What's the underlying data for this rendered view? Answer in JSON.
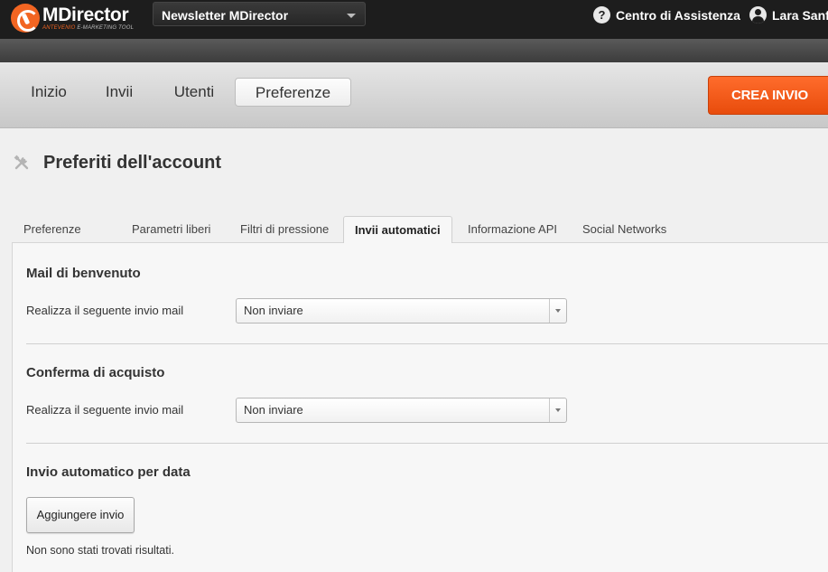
{
  "header": {
    "logo": {
      "name": "MDirector",
      "tagline_brand": "ANTEVENIO",
      "tagline_rest": "E-MARKETING TOOL",
      "accent": "#f26522"
    },
    "newsletter_select": {
      "value": "Newsletter MDirector"
    },
    "help": {
      "label": "Centro di Assistenza",
      "icon": "question-icon"
    },
    "user": {
      "name": "Lara Sanf",
      "icon": "user-icon"
    }
  },
  "nav": {
    "items": [
      {
        "label": "Inizio"
      },
      {
        "label": "Invii"
      },
      {
        "label": "Utenti"
      },
      {
        "label": "Preferenze",
        "active": true
      }
    ],
    "cta_label": "CREA INVIO",
    "cta_color": "#f05a1a"
  },
  "page": {
    "title": "Preferiti dell'account",
    "icon": "tools-icon"
  },
  "tabs": [
    {
      "label": "Preferenze"
    },
    {
      "label": "Parametri liberi"
    },
    {
      "label": "Filtri di pressione"
    },
    {
      "label": "Invii automatici",
      "active": true
    },
    {
      "label": "Informazione API"
    },
    {
      "label": "Social Networks"
    }
  ],
  "sections": {
    "welcome": {
      "title": "Mail di benvenuto",
      "field_label": "Realizza il seguente invio mail",
      "select_value": "Non inviare"
    },
    "purchase": {
      "title": "Conferma di acquisto",
      "field_label": "Realizza il seguente invio mail",
      "select_value": "Non inviare"
    },
    "by_date": {
      "title": "Invio automatico per data",
      "add_button": "Aggiungere invio",
      "empty_text": "Non sono stati trovati risultati."
    }
  }
}
